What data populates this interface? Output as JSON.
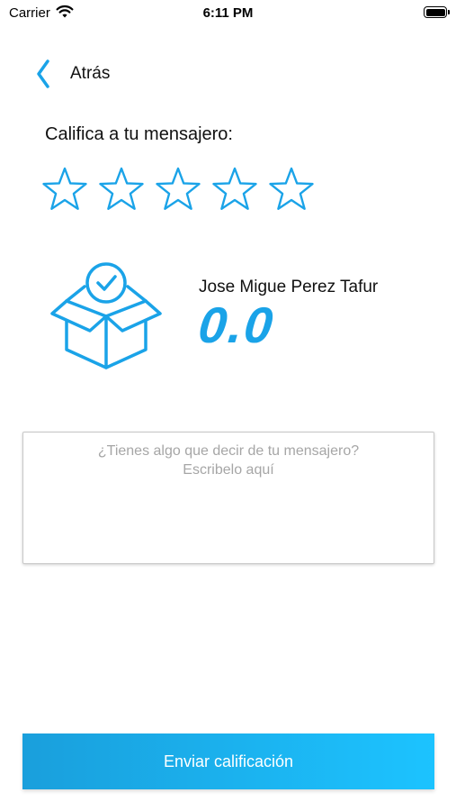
{
  "status_bar": {
    "carrier": "Carrier",
    "time": "6:11 PM",
    "battery_level": 1.0
  },
  "nav": {
    "back_label": "Atrás"
  },
  "rating": {
    "title": "Califica a tu mensajero:",
    "star_count": 5,
    "selected_stars": 0
  },
  "courier": {
    "name": "Jose Migue Perez Tafur",
    "score": "0.0"
  },
  "comment": {
    "placeholder": "¿Tienes algo que decir de tu mensajero?\nEscribelo aquí",
    "value": ""
  },
  "submit": {
    "label": "Enviar calificación"
  },
  "colors": {
    "accent": "#1aa3e8",
    "button_start": "#1a9fdc",
    "button_end": "#1cc3ff"
  },
  "icons": {
    "back": "chevron-left-icon",
    "star": "star-outline-icon",
    "box": "package-check-icon"
  }
}
